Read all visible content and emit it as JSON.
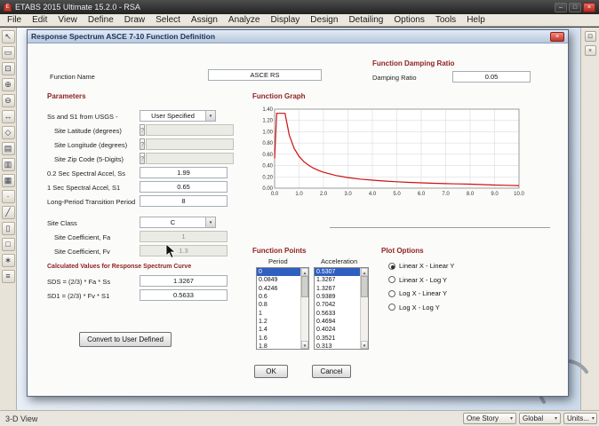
{
  "app": {
    "title": "ETABS 2015 Ultimate 15.2.0 - RSA",
    "menus": [
      "File",
      "Edit",
      "View",
      "Define",
      "Draw",
      "Select",
      "Assign",
      "Analyze",
      "Display",
      "Design",
      "Detailing",
      "Options",
      "Tools",
      "Help"
    ],
    "left_toolbar_icons": [
      {
        "name": "select-pointer-icon",
        "glyph": "↖"
      },
      {
        "name": "reshape-object-icon",
        "glyph": "▭"
      },
      {
        "name": "zoom-window-icon",
        "glyph": "⊡"
      },
      {
        "name": "zoom-in-icon",
        "glyph": "⊕"
      },
      {
        "name": "zoom-out-icon",
        "glyph": "⊖"
      },
      {
        "name": "pan-icon",
        "glyph": "↔"
      },
      {
        "name": "three-d-view-icon",
        "glyph": "◇"
      },
      {
        "name": "plan-view-icon",
        "glyph": "▤"
      },
      {
        "name": "elevation-view-icon",
        "glyph": "▥"
      },
      {
        "name": "grid-icon",
        "glyph": "▦"
      },
      {
        "name": "draw-joint-icon",
        "glyph": "·"
      },
      {
        "name": "draw-frame-icon",
        "glyph": "╱"
      },
      {
        "name": "draw-wall-icon",
        "glyph": "▯"
      },
      {
        "name": "draw-area-icon",
        "glyph": "□"
      },
      {
        "name": "snap-icon",
        "glyph": "∗"
      },
      {
        "name": "measure-icon",
        "glyph": "≡"
      }
    ],
    "status": {
      "view": "3-D View",
      "story": "One Story",
      "coord": "Global",
      "units": "Units..."
    }
  },
  "icons": {
    "app_logo": "E",
    "minimize": "–",
    "maximize": "□",
    "close": "×",
    "dialog_close": "×",
    "panel_dock": "⊡",
    "panel_close": "×",
    "dropdown_arrow": "▾",
    "scroll_up": "▲",
    "scroll_down": "▼",
    "question": "?"
  },
  "dialog": {
    "title": "Response Spectrum ASCE 7-10 Function Definition",
    "function_name": {
      "label": "Function Name",
      "value": "ASCE RS"
    },
    "damping": {
      "section_title": "Function Damping Ratio",
      "label": "Damping Ratio",
      "value": "0.05"
    },
    "parameters": {
      "section_title": "Parameters",
      "usgs": {
        "label": "Ss and S1 from USGS -",
        "value": "User Specified"
      },
      "latitude": {
        "label": "Site Latitude (degrees)",
        "value": ""
      },
      "longitude": {
        "label": "Site Longitude (degrees)",
        "value": ""
      },
      "zipcode": {
        "label": "Site Zip Code (5-Digits)",
        "value": ""
      },
      "ss": {
        "label": "0.2 Sec Spectral Accel, Ss",
        "value": "1.99"
      },
      "s1": {
        "label": "1 Sec Spectral Accel, S1",
        "value": "0.65"
      },
      "tl": {
        "label": "Long-Period Transition Period",
        "value": "8"
      },
      "site_class": {
        "label": "Site Class",
        "value": "C"
      },
      "fa": {
        "label": "Site Coefficient, Fa",
        "value": "1"
      },
      "fv": {
        "label": "Site Coefficient, Fv",
        "value": "1.3"
      },
      "calc_title": "Calculated Values for Response Spectrum Curve",
      "sds": {
        "label": "SDS = (2/3) * Fa * Ss",
        "value": "1.3267"
      },
      "sd1": {
        "label": "SD1 = (2/3) * Fv * S1",
        "value": "0.5633"
      },
      "convert_button": "Convert to User Defined"
    },
    "graph": {
      "section_title": "Function Graph"
    },
    "points": {
      "section_title": "Function Points",
      "period_header": "Period",
      "accel_header": "Acceleration",
      "selected_index": 0,
      "periods": [
        "0",
        "0.0849",
        "0.4246",
        "0.6",
        "0.8",
        "1",
        "1.2",
        "1.4",
        "1.6",
        "1.8"
      ],
      "accels": [
        "0.5307",
        "1.3267",
        "1.3267",
        "0.9389",
        "0.7042",
        "0.5633",
        "0.4694",
        "0.4024",
        "0.3521",
        "0.313"
      ]
    },
    "plot_options": {
      "section_title": "Plot Options",
      "options": [
        "Linear X - Linear Y",
        "Linear X - Log Y",
        "Log X - Linear Y",
        "Log X - Log Y"
      ],
      "selected": "Linear X - Linear Y"
    },
    "ok": "OK",
    "cancel": "Cancel"
  },
  "chart_data": {
    "type": "line",
    "title": "Function Graph",
    "x": [
      0,
      0.0849,
      0.4246,
      0.6,
      0.8,
      1,
      1.2,
      1.4,
      1.6,
      1.8,
      2,
      2.5,
      3,
      3.5,
      4,
      4.5,
      5,
      5.5,
      6,
      6.5,
      7,
      7.5,
      8,
      8.5,
      9,
      9.5,
      10
    ],
    "y": [
      0.5307,
      1.3267,
      1.3267,
      0.9389,
      0.7042,
      0.5633,
      0.4694,
      0.4024,
      0.3521,
      0.313,
      0.2817,
      0.2253,
      0.1878,
      0.1609,
      0.1408,
      0.1252,
      0.1127,
      0.1024,
      0.0939,
      0.0867,
      0.0805,
      0.0751,
      0.0704,
      0.0624,
      0.0556,
      0.0499,
      0.0451
    ],
    "xlim": [
      0,
      10
    ],
    "ylim": [
      0,
      1.4
    ],
    "x_ticks": [
      "0.0",
      "1.0",
      "2.0",
      "3.0",
      "4.0",
      "5.0",
      "6.0",
      "7.0",
      "8.0",
      "9.0",
      "10.0"
    ],
    "y_ticks": [
      "0.00",
      "0.20",
      "0.40",
      "0.60",
      "0.80",
      "1.00",
      "1.20",
      "1.40"
    ],
    "grid": true,
    "legend": false,
    "line_color": "#cc1111"
  }
}
